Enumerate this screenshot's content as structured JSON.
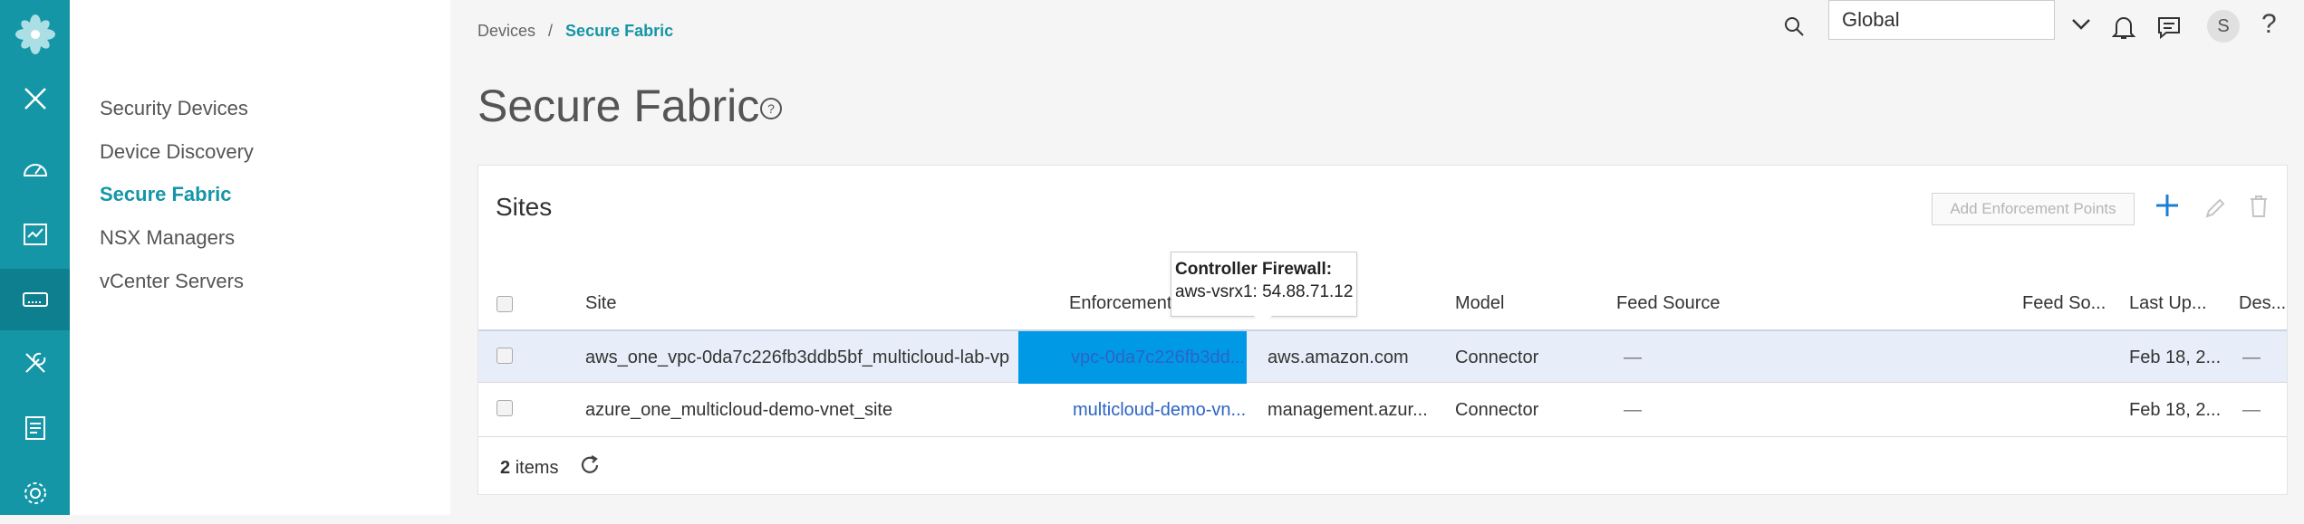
{
  "breadcrumb": {
    "parent": "Devices",
    "separator": "/",
    "current": "Secure Fabric"
  },
  "page": {
    "title": "Secure Fabric"
  },
  "header": {
    "scope_value": "Global",
    "avatar_initial": "S",
    "help": "?"
  },
  "subnav": {
    "items": [
      {
        "label": "Security Devices"
      },
      {
        "label": "Device Discovery"
      },
      {
        "label": "Secure Fabric"
      },
      {
        "label": "NSX Managers"
      },
      {
        "label": "vCenter Servers"
      }
    ]
  },
  "card": {
    "title": "Sites",
    "add_enforcement_points_label": "Add Enforcement Points"
  },
  "table": {
    "columns": [
      "Site",
      "Enforcement",
      "Model",
      "Feed Source",
      "Feed So...",
      "Last Up...",
      "Des..."
    ],
    "rows": [
      {
        "site": "aws_one_vpc-0da7c226fb3ddb5bf_multicloud-lab-vp...",
        "enforcement": "vpc-0da7c226fb3dd...",
        "host": "aws.amazon.com",
        "model": "Connector",
        "feed_source": "—",
        "last_updated": "Feb 18, 2...",
        "description": "—"
      },
      {
        "site": "azure_one_multicloud-demo-vnet_site",
        "enforcement": "multicloud-demo-vn...",
        "host": "management.azur...",
        "model": "Connector",
        "feed_source": "—",
        "last_updated": "Feb 18, 2...",
        "description": "—"
      }
    ]
  },
  "footer": {
    "count": "2",
    "count_label": "items"
  },
  "tooltip": {
    "title": "Controller Firewall:",
    "body": "aws-vsrx1: 54.88.71.12"
  },
  "icons": {
    "rail": [
      "logo-flower-icon",
      "close-icon",
      "dashboard-gauge-icon",
      "monitor-chart-icon",
      "devices-icon",
      "tools-icon",
      "reports-icon",
      "settings-gear-icon"
    ]
  },
  "colors": {
    "rail": "#1596a6",
    "accent": "#1596a6",
    "link": "#2c64c5",
    "selected_cell": "#0099e6",
    "selected_row": "#e7eef9"
  }
}
